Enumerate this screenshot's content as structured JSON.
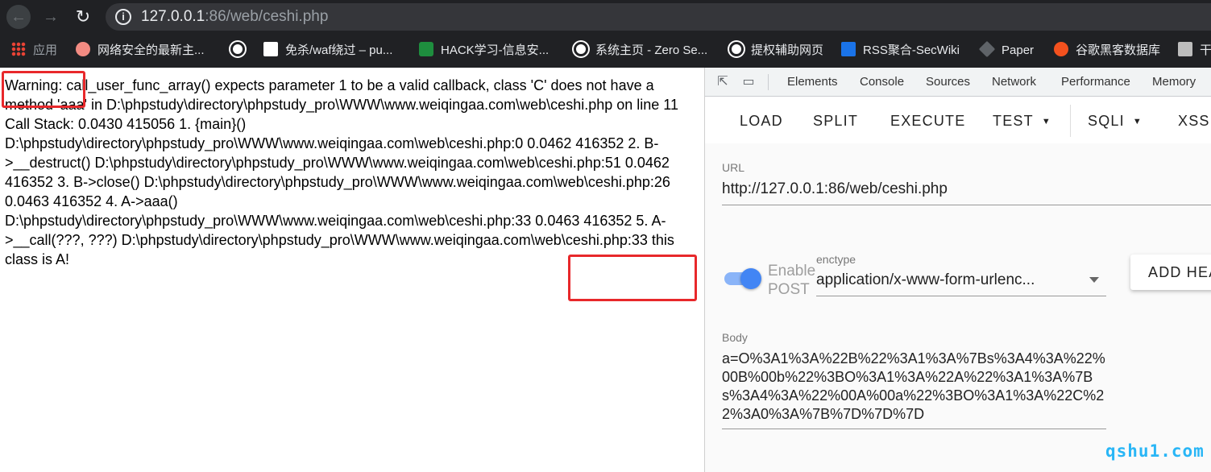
{
  "browser": {
    "url_host": "127.0.0.1",
    "url_rest": ":86/web/ceshi.php",
    "icons": {
      "back": "back-arrow-icon",
      "forward": "forward-arrow-icon",
      "reload": "reload-icon",
      "info": "info-icon"
    }
  },
  "bookmarks": [
    {
      "label": "应用",
      "icon": "apps-grid-icon"
    },
    {
      "label": "网络安全的最新主...",
      "icon": "chat-bubble-icon"
    },
    {
      "label": "",
      "icon": "globe-icon"
    },
    {
      "label": "免杀/waf绕过 – pu...",
      "icon": "site-favicon"
    },
    {
      "label": "HACK学习-信息安...",
      "icon": "hack-favicon"
    },
    {
      "label": "系统主页 - Zero Se...",
      "icon": "globe-icon"
    },
    {
      "label": "提权辅助网页",
      "icon": "globe-icon"
    },
    {
      "label": "RSS聚合-SecWiki",
      "icon": "secwiki-favicon"
    },
    {
      "label": "Paper",
      "icon": "paper-favicon"
    },
    {
      "label": "谷歌黑客数据库",
      "icon": "flame-favicon"
    },
    {
      "label": "干",
      "icon": "avatar-favicon"
    }
  ],
  "page": {
    "warning_text": "Warning: call_user_func_array() expects parameter 1 to be a valid callback, class 'C' does not have a method 'aaa' in D:\\phpstudy\\directory\\phpstudy_pro\\WWW\\www.weiqingaa.com\\web\\ceshi.php on line 11 Call Stack: 0.0430 415056 1. {main}() D:\\phpstudy\\directory\\phpstudy_pro\\WWW\\www.weiqingaa.com\\web\\ceshi.php:0 0.0462 416352 2. B->__destruct() D:\\phpstudy\\directory\\phpstudy_pro\\WWW\\www.weiqingaa.com\\web\\ceshi.php:51 0.0462 416352 3. B->close() D:\\phpstudy\\directory\\phpstudy_pro\\WWW\\www.weiqingaa.com\\web\\ceshi.php:26 0.0463 416352 4. A->aaa() D:\\phpstudy\\directory\\phpstudy_pro\\WWW\\www.weiqingaa.com\\web\\ceshi.php:33 0.0463 416352 5. A->__call(???, ???) D:\\phpstudy\\directory\\phpstudy_pro\\WWW\\www.weiqingaa.com\\web\\ceshi.php:33 this class is A!",
    "highlight_color": "#e8282b"
  },
  "devtools": {
    "tabs": [
      "Elements",
      "Console",
      "Sources",
      "Network",
      "Performance",
      "Memory"
    ],
    "icons": {
      "inspect": "inspect-cursor-icon",
      "device": "device-toggle-icon"
    }
  },
  "hackbar": {
    "buttons": {
      "load": "LOAD",
      "split": "SPLIT",
      "execute": "EXECUTE",
      "test": "TEST",
      "sqli": "SQLI",
      "xss": "XSS"
    },
    "url_label": "URL",
    "url_value": "http://127.0.0.1:86/web/ceshi.php",
    "enable_post_label": "Enable POST",
    "enable_post_on": true,
    "enctype_label": "enctype",
    "enctype_value": "application/x-www-form-urlenc...",
    "add_header_label": "ADD HEA",
    "body_label": "Body",
    "body_value": "a=O%3A1%3A%22B%22%3A1%3A%7Bs%3A4%3A%22%00B%00b%22%3BO%3A1%3A%22A%22%3A1%3A%7Bs%3A4%3A%22%00A%00a%22%3BO%3A1%3A%22C%22%3A0%3A%7B%7D%7D%7D",
    "accent_color": "#4285f4"
  },
  "watermark": "qshu1.com"
}
